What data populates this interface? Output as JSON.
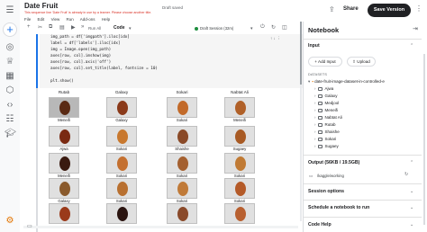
{
  "notebook": {
    "title": "Date Fruit",
    "saved_status": "Draft saved",
    "warning": "This sequence line 'Date Fruit' is already in use by a learner. Please choose another title."
  },
  "menu": [
    "File",
    "Edit",
    "View",
    "Run",
    "Add-ons",
    "Help"
  ],
  "header": {
    "share_label": "Share",
    "save_version_label": "Save Version"
  },
  "toolbar": {
    "run_all_label": "Run All",
    "cell_type": "Code",
    "session_status": "Draft Session (32m)"
  },
  "code_lines": [
    "img_path = df['imgpath'].iloc[idx]",
    "label = df['labels'].iloc[idx]",
    "img = Image.open(img_path)",
    "axes[row, col].imshow(img)",
    "axes[row, col].axis('off')",
    "axes[row, col].set_title(label, fontsize = 10)",
    "",
    "plt.show()"
  ],
  "image_grid": {
    "column_headers": [
      "Rutab",
      "Galaxy",
      "Sokari",
      "Nabtat Ali"
    ],
    "rows": [
      [
        "Meneifi",
        "Galaxy",
        "Sokari",
        "Meneifi"
      ],
      [
        "Ajwa",
        "Sokari",
        "Shaishe",
        "Sugaey"
      ],
      [
        "Meneifi",
        "Sokari",
        "Sokari",
        "Sokari"
      ],
      [
        "Galaxy",
        "Sokari",
        "Sokari",
        "Sokari"
      ],
      [
        "",
        "",
        "",
        ""
      ]
    ],
    "fruit_colors": [
      [
        "#5a2a14",
        "#8a3a1a",
        "#c26a2a",
        "#b06028"
      ],
      [
        "#7a2a12",
        "#c8782e",
        "#8a4a28",
        "#a85a24"
      ],
      [
        "#3a1a10",
        "#c47030",
        "#a46030",
        "#c07a34"
      ],
      [
        "#8a5a2c",
        "#b87030",
        "#c07a38",
        "#b45a28"
      ],
      [
        "#9a3a1a",
        "#2a1410",
        "#8a4a2a",
        "#b86030"
      ]
    ]
  },
  "panel": {
    "title": "Notebook",
    "input_section": "Input",
    "add_input_label": "Add Input",
    "upload_label": "Upload",
    "datasets_header": "DATASETS",
    "dataset_name": "date-fruit-image-dataset-in-controlled-e",
    "folders": [
      "Ajwa",
      "Galaxy",
      "Medjool",
      "Meneifi",
      "Nabtat Ali",
      "Rutab",
      "Shaishe",
      "Sokari",
      "Sugaey"
    ],
    "output_section": "Output (56KB / 19.5GB)",
    "output_path": "/kaggle/working",
    "session_options": "Session options",
    "schedule": "Schedule a notebook to run",
    "code_help": "Code Help"
  }
}
